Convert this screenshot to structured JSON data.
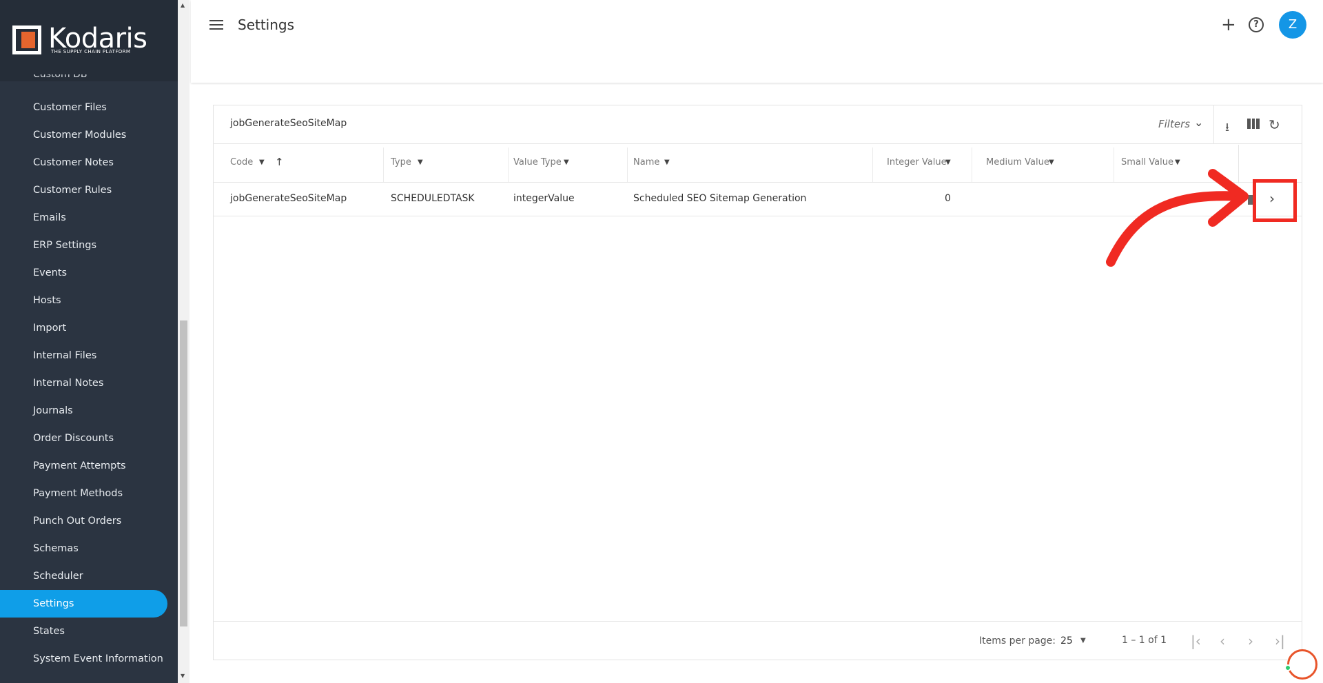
{
  "brand": {
    "name": "Kodaris",
    "tagline": "THE SUPPLY CHAIN PLATFORM",
    "accent": "#0f9ee8",
    "logo_color": "#e5652e"
  },
  "sidebar": {
    "cut_item": "Custom DB",
    "items": [
      {
        "label": "Customer Files"
      },
      {
        "label": "Customer Modules"
      },
      {
        "label": "Customer Notes"
      },
      {
        "label": "Customer Rules"
      },
      {
        "label": "Emails"
      },
      {
        "label": "ERP Settings"
      },
      {
        "label": "Events"
      },
      {
        "label": "Hosts"
      },
      {
        "label": "Import"
      },
      {
        "label": "Internal Files"
      },
      {
        "label": "Internal Notes"
      },
      {
        "label": "Journals"
      },
      {
        "label": "Order Discounts"
      },
      {
        "label": "Payment Attempts"
      },
      {
        "label": "Payment Methods"
      },
      {
        "label": "Punch Out Orders"
      },
      {
        "label": "Schemas"
      },
      {
        "label": "Scheduler"
      },
      {
        "label": "Settings",
        "active": true
      },
      {
        "label": "States"
      },
      {
        "label": "System Event Information"
      }
    ]
  },
  "header": {
    "title": "Settings",
    "avatar_initial": "Z"
  },
  "card": {
    "title": "jobGenerateSeoSiteMap",
    "filters_label": "Filters",
    "columns": [
      "Code",
      "Type",
      "Value Type",
      "Name",
      "Integer Value",
      "Medium Value",
      "Small Value"
    ],
    "rows": [
      {
        "code": "jobGenerateSeoSiteMap",
        "type": "SCHEDULEDTASK",
        "value_type": "integerValue",
        "name": "Scheduled SEO Sitemap Generation",
        "integer_value": "0"
      }
    ]
  },
  "paginator": {
    "items_per_page_label": "Items per page:",
    "items_per_page": "25",
    "range": "1 – 1 of 1"
  },
  "annotation_color": "#f02a22"
}
